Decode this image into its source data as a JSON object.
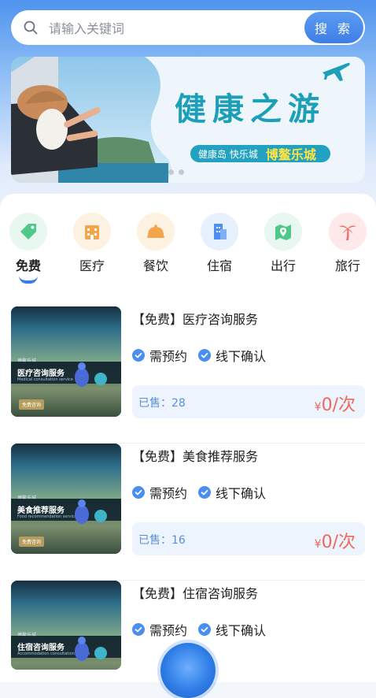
{
  "search": {
    "placeholder": "请输入关键词",
    "button_label": "搜 索"
  },
  "banner": {
    "title": "健康之游",
    "subtitle": "健康岛 快乐城",
    "brand": "博鳌乐城"
  },
  "categories": [
    {
      "label": "免费",
      "icon": "tag-icon",
      "color": "#4fc98a",
      "bg": "#e8f7ef"
    },
    {
      "label": "医疗",
      "icon": "hospital-icon",
      "color": "#f3a54a",
      "bg": "#fdf1e2"
    },
    {
      "label": "餐饮",
      "icon": "cloche-icon",
      "color": "#f3a54a",
      "bg": "#fdf1e2"
    },
    {
      "label": "住宿",
      "icon": "building-icon",
      "color": "#4d8ff0",
      "bg": "#e7f0fd"
    },
    {
      "label": "出行",
      "icon": "map-pin-icon",
      "color": "#4fc98a",
      "bg": "#e8f7ef"
    },
    {
      "label": "旅行",
      "icon": "palm-tree-icon",
      "color": "#ef6a6a",
      "bg": "#fde9e9"
    }
  ],
  "services": [
    {
      "title": "【免费】医疗咨询服务",
      "badge1": "需预约",
      "badge2": "线下确认",
      "sold": "已售：28",
      "price_symbol": "¥",
      "price": "0",
      "price_unit": "/次",
      "thumb_caption": "医疗咨询服务",
      "thumb_caption_en": "Medical consultation service",
      "thumb_small": "博鳌乐城",
      "thumb_tag": "免费咨询"
    },
    {
      "title": "【免费】美食推荐服务",
      "badge1": "需预约",
      "badge2": "线下确认",
      "sold": "已售：16",
      "price_symbol": "¥",
      "price": "0",
      "price_unit": "/次",
      "thumb_caption": "美食推荐服务",
      "thumb_caption_en": "Food recommendation service",
      "thumb_small": "博鳌乐城",
      "thumb_tag": "免费咨询"
    },
    {
      "title": "【免费】住宿咨询服务",
      "badge1": "需预约",
      "badge2": "线下确认",
      "thumb_caption": "住宿咨询服务",
      "thumb_caption_en": "Accommodation consultation service",
      "thumb_small": "博鳌乐城"
    }
  ],
  "colors": {
    "accent": "#3b7de8",
    "price": "#ec6a5b",
    "sold": "#5b8fd6"
  }
}
